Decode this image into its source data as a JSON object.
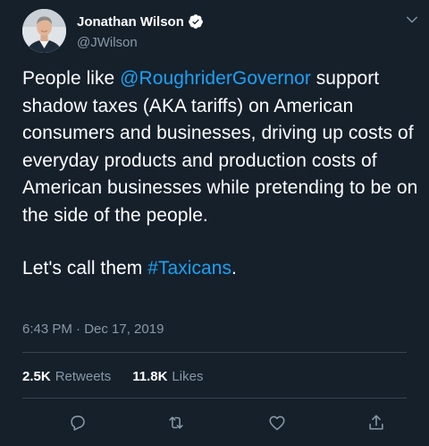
{
  "author": {
    "display_name": "Jonathan Wilson",
    "handle": "@JWilson",
    "verified": true
  },
  "tweet": {
    "paragraph1_prefix": "People like ",
    "mention": "@RoughriderGovernor",
    "paragraph1_suffix": " support shadow taxes (AKA tariffs) on American consumers and businesses, driving up costs of everyday products and production costs of American businesses while pretending to be on the side of the people.",
    "paragraph2_prefix": "Let's call them ",
    "hashtag": "#Taxicans",
    "paragraph2_suffix": "."
  },
  "timestamp": "6:43 PM · Dec 17, 2019",
  "stats": {
    "retweets_count": "2.5K",
    "retweets_label": "Retweets",
    "likes_count": "11.8K",
    "likes_label": "Likes"
  },
  "icons": {
    "reply": "reply-icon",
    "retweet": "retweet-icon",
    "like": "like-icon",
    "share": "share-icon",
    "caret": "chevron-down-icon",
    "verified": "verified-badge-icon"
  },
  "colors": {
    "background": "#15202b",
    "link": "#1da1f2",
    "secondary_text": "#8899a6",
    "divider": "#38444d",
    "text": "#ffffff"
  }
}
